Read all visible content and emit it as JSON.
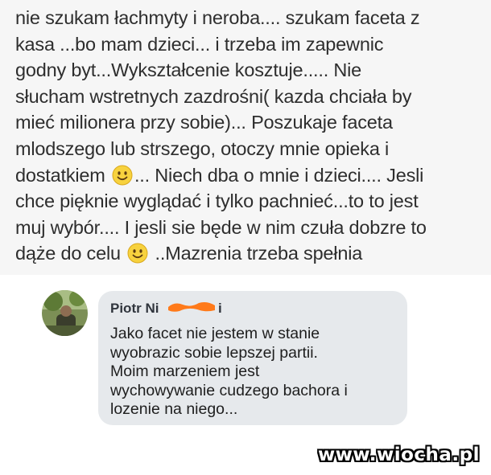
{
  "post": {
    "line1": "nie szukam łachmyty i neroba.... szukam faceta z",
    "line2": "kasa ...bo mam dzieci... i trzeba im zapewnic",
    "line3": "godny byt...Wykształcenie kosztuje..... Nie",
    "line4": "słucham wstretnych zazdrośni( kazda chciała by",
    "line5": "mieć milionera przy sobie)... Poszukaje faceta",
    "line6": "mlodszego lub strszego, otoczy mnie opieka i",
    "line7a": "dostatkiem ",
    "line7b": "... Niech dba o mnie i dzieci.... Jesli",
    "line8": "chce pięknie wyglądać i tylko pachnieć...to to jest",
    "line9": "muj wybór.... I jesli sie będe w nim czuła dobzre to",
    "line10a": "dąże do celu ",
    "line10b": " ..Mazrenia trzeba spełnia",
    "emoji_icon": "smiley-icon"
  },
  "comment": {
    "author_start": "Piotr Ni",
    "author_end": "i",
    "redaction_color": "#ff7a1a",
    "text": "Jako facet nie jestem w stanie\nwyobrazic sobie lepszej partii.\nMoim marzeniem jest\nwychowywanie cudzego bachora i\nlozenie na niego..."
  },
  "watermark": "www.wiocha.pl"
}
